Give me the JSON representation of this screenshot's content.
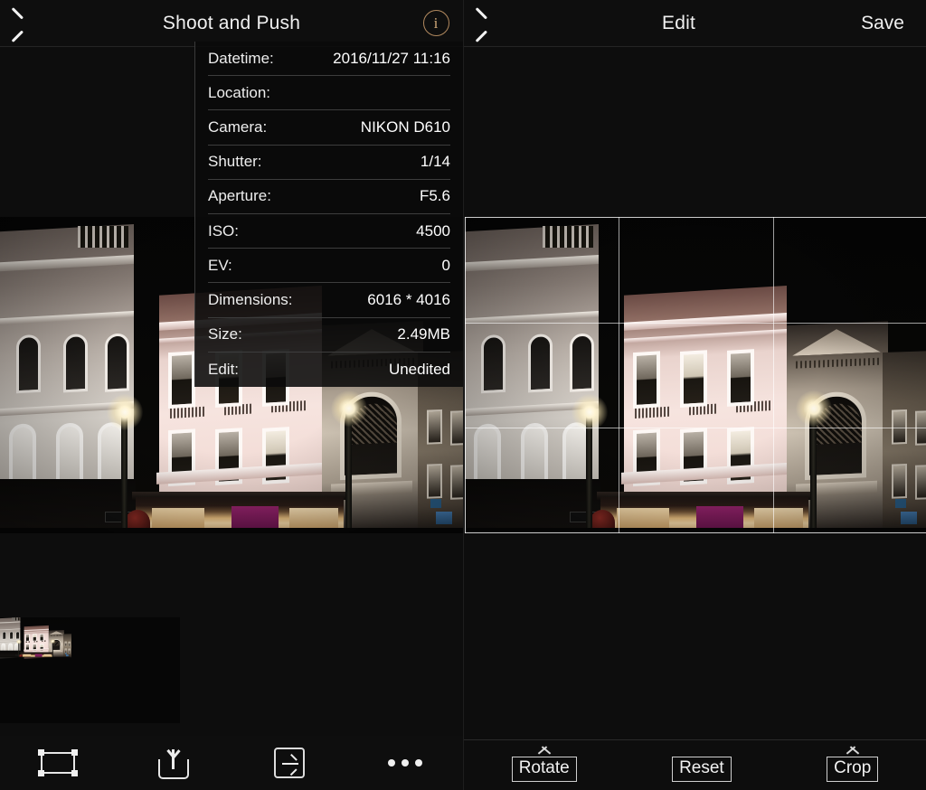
{
  "left_panel": {
    "header": {
      "back_icon": "chevron-left-icon",
      "title": "Shoot and Push",
      "info_icon": "info-circle-icon",
      "info_icon_color": "#b0885e"
    },
    "info_overlay": {
      "rows": [
        {
          "key": "Datetime:",
          "value": "2016/11/27 11:16"
        },
        {
          "key": "Location:",
          "value": ""
        },
        {
          "key": "Camera:",
          "value": "NIKON D610"
        },
        {
          "key": "Shutter:",
          "value": "1/14"
        },
        {
          "key": "Aperture:",
          "value": "F5.6"
        },
        {
          "key": "ISO:",
          "value": "4500"
        },
        {
          "key": "EV:",
          "value": "0"
        },
        {
          "key": "Dimensions:",
          "value": "6016 * 4016"
        },
        {
          "key": "Size:",
          "value": "2.49MB"
        },
        {
          "key": "Edit:",
          "value": "Unedited"
        }
      ]
    },
    "photo": {
      "alt": "night street scene with victorian storefront buildings"
    },
    "thumbnail": {
      "alt": "thumbnail of night street scene"
    },
    "toolbar": {
      "items": [
        {
          "icon": "crop-frame-icon"
        },
        {
          "icon": "share-upload-icon"
        },
        {
          "icon": "arrow-right-box-icon"
        },
        {
          "icon": "more-ellipsis-icon"
        }
      ]
    }
  },
  "right_panel": {
    "header": {
      "back_icon": "chevron-left-icon",
      "title": "Edit",
      "save_label": "Save"
    },
    "photo": {
      "alt": "night street scene with crop grid overlay"
    },
    "crop_grid": {
      "enabled": true,
      "vertical_fractions": [
        0.3333,
        0.6667
      ],
      "horizontal_fractions": [
        0.3333,
        0.6667
      ]
    },
    "toolbar": {
      "items": [
        {
          "label": "Rotate",
          "caret": true
        },
        {
          "label": "Reset",
          "caret": false
        },
        {
          "label": "Crop",
          "caret": true
        }
      ]
    }
  },
  "colors": {
    "background": "#0a0a0a",
    "header_bg": "#0e0e0e",
    "text": "#f0f0f0",
    "accent": "#b0885e",
    "divider": "#3d3d3d"
  }
}
